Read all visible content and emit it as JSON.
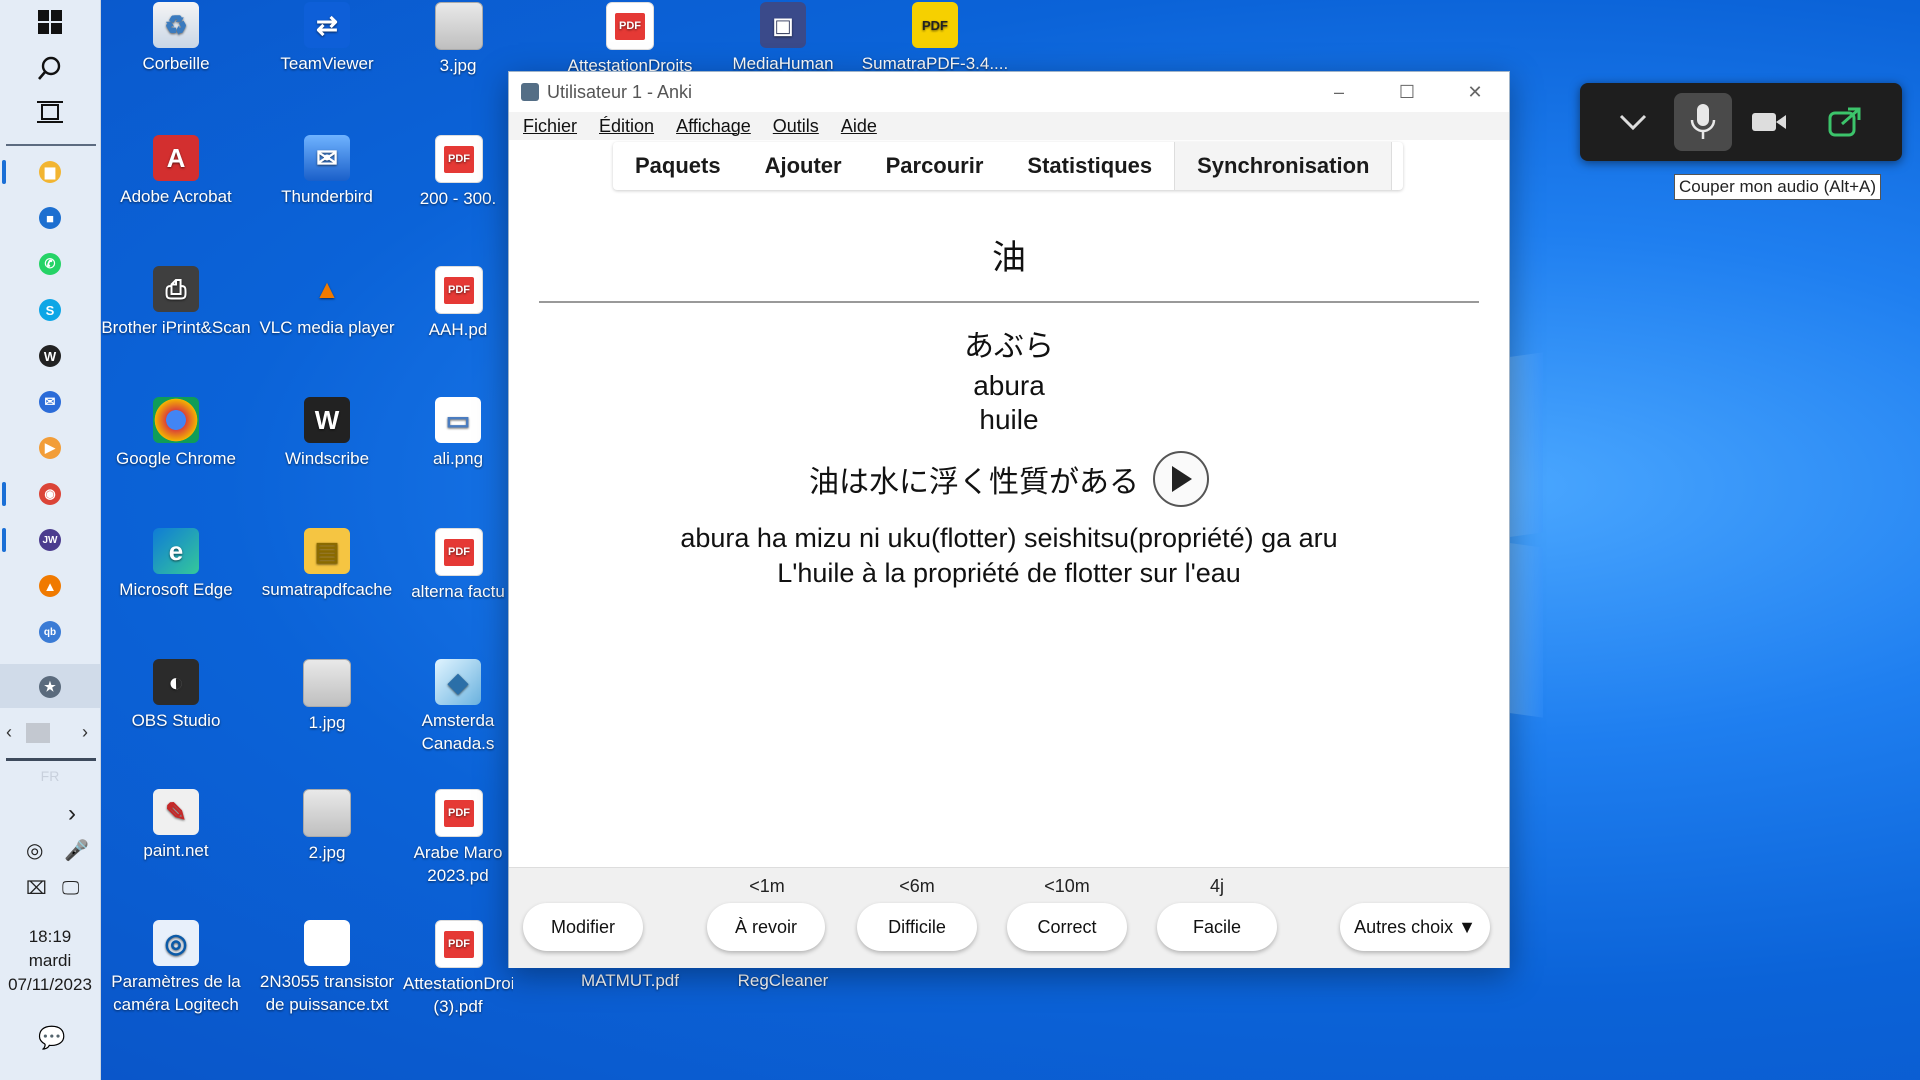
{
  "taskbar": {
    "time": "18:19",
    "day": "mardi",
    "date": "07/11/2023",
    "lang": "FR",
    "apps": [
      {
        "name": "file-explorer-icon",
        "color": "#f2b531",
        "glyph": "▆"
      },
      {
        "name": "microsoft-store-icon",
        "color": "#1d6fd0",
        "glyph": "■"
      },
      {
        "name": "whatsapp-icon",
        "color": "#25d366",
        "glyph": "✆"
      },
      {
        "name": "skype-icon",
        "color": "#0da6e6",
        "glyph": "S"
      },
      {
        "name": "windscribe-icon",
        "color": "#222",
        "glyph": "W"
      },
      {
        "name": "thunderbird-icon",
        "color": "#2a6bd8",
        "glyph": "✉"
      },
      {
        "name": "media-player-icon",
        "color": "#f29d38",
        "glyph": "▶"
      },
      {
        "name": "chrome-icon",
        "color": "#db4437",
        "glyph": "◉"
      },
      {
        "name": "jw-icon",
        "color": "#4b3c8e",
        "glyph": "JW"
      },
      {
        "name": "vlc-icon",
        "color": "#f07a00",
        "glyph": "▲"
      },
      {
        "name": "qbittorrent-icon",
        "color": "#3a7bd5",
        "glyph": "qb"
      },
      {
        "name": "anki-icon",
        "color": "#5b6b7d",
        "glyph": "★"
      }
    ]
  },
  "desktop": {
    "col1": [
      "Corbeille",
      "Adobe Acrobat",
      "Brother iPrint&Scan",
      "Google Chrome",
      "Microsoft Edge",
      "OBS Studio",
      "paint.net",
      "Paramètres de la caméra Logitech"
    ],
    "col2": [
      "TeamViewer",
      "Thunderbird",
      "VLC media player",
      "Windscribe",
      "sumatrapdfcache",
      "1.jpg",
      "2.jpg",
      "2N3055 transistor de puissance.txt"
    ],
    "col3": [
      "3.jpg",
      "200 - 300.",
      "AAH.pd",
      "ali.png",
      "alterna factu",
      "Amsterda Canada.s",
      "Arabe Maro 2023.pd",
      "AttestationDroits (3).pdf"
    ],
    "top_partial": [
      "AttestationDroits",
      "MediaHuman",
      "SumatraPDF-3.4...."
    ],
    "bottom_partial": [
      "MATMUT.pdf",
      "RegCleaner"
    ]
  },
  "anki": {
    "title": "Utilisateur 1 - Anki",
    "menu": [
      "Fichier",
      "Édition",
      "Affichage",
      "Outils",
      "Aide"
    ],
    "tabs": [
      "Paquets",
      "Ajouter",
      "Parcourir",
      "Statistiques",
      "Synchronisation"
    ],
    "card": {
      "front": "油",
      "reading": "あぶら",
      "romaji": "abura",
      "meaning": "huile",
      "sentence": "油は水に浮く性質がある",
      "sentence_romaji": "abura ha mizu ni uku(flotter) seishitsu(propriété) ga aru",
      "sentence_translation": "L'huile à la propriété de flotter sur l'eau"
    },
    "intervals": [
      "<1m",
      "<6m",
      "<10m",
      "4j"
    ],
    "buttons": {
      "edit": "Modifier",
      "again": "À revoir",
      "hard": "Difficile",
      "good": "Correct",
      "easy": "Facile",
      "more": "Autres choix ▼"
    }
  },
  "zoom": {
    "tooltip": "Couper mon audio (Alt+A)"
  }
}
